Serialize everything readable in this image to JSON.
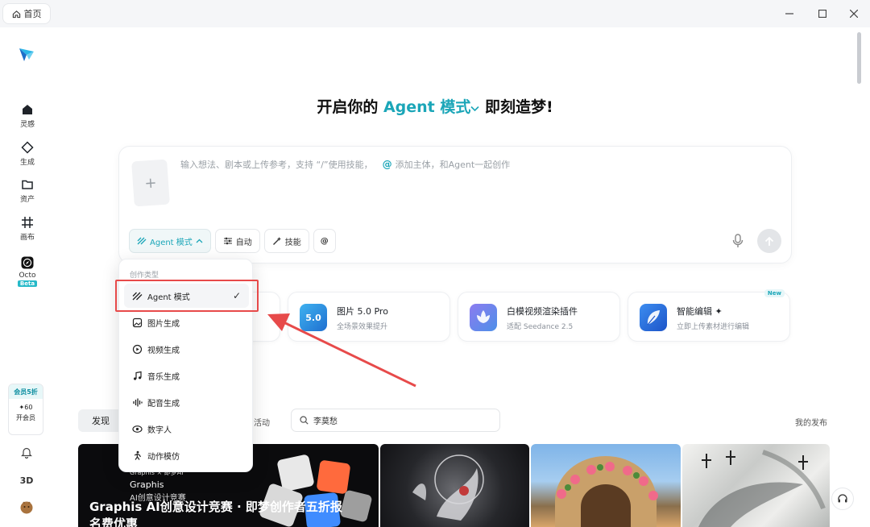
{
  "titlebar": {
    "home_label": "首页"
  },
  "sidebar": {
    "items": [
      {
        "label": "灵感",
        "icon": "home-icon"
      },
      {
        "label": "生成",
        "icon": "diamond-icon"
      },
      {
        "label": "资产",
        "icon": "folder-icon"
      },
      {
        "label": "画布",
        "icon": "canvas-icon"
      },
      {
        "label": "Octo",
        "icon": "compass-icon",
        "badge": "Beta"
      }
    ],
    "vip": {
      "tag": "会员5折",
      "credits": "✦60",
      "open": "开会员"
    },
    "bottom": {
      "label_3d": "3D"
    }
  },
  "headline": {
    "prefix": "开启你的",
    "mode": "Agent 模式",
    "suffix": "即刻造梦!"
  },
  "prompt": {
    "placeholder_a": "输入想法、剧本或上传参考，支持 “/”使用技能，",
    "placeholder_at": "@",
    "placeholder_b": "添加主体，和Agent一起创作",
    "toolbar": {
      "mode": "Agent 模式",
      "auto": "自动",
      "skill": "技能",
      "at": "@"
    }
  },
  "feature_cards": [
    {
      "title": "图片 5.0 Pro",
      "sub": "全场景效果提升",
      "icon_text": "5.0"
    },
    {
      "title": "白模视频渲染插件",
      "sub": "适配 Seedance 2.5"
    },
    {
      "title": "智能编辑 ✦",
      "sub": "立即上传素材进行编辑",
      "badge": "New"
    }
  ],
  "feed": {
    "tab_discover": "发现",
    "tab_activity": "活动",
    "search_value": "李莫愁",
    "my_publish": "我的发布",
    "promo": {
      "brand_small": "Graphis × 即梦AI",
      "line1": "Graphis",
      "line2": "AI创意设计竞赛",
      "title1": "Graphis AI创意设计竞赛 · 即梦创作者五折报",
      "title2": "名费优惠"
    }
  },
  "dropdown": {
    "header": "创作类型",
    "items": [
      {
        "label": "Agent 模式",
        "icon": "agent-icon",
        "selected": true
      },
      {
        "label": "图片生成",
        "icon": "image-icon"
      },
      {
        "label": "视频生成",
        "icon": "video-icon"
      },
      {
        "label": "音乐生成",
        "icon": "music-icon"
      },
      {
        "label": "配音生成",
        "icon": "voice-icon"
      },
      {
        "label": "数字人",
        "icon": "digital-human-icon"
      },
      {
        "label": "动作模仿",
        "icon": "motion-icon"
      }
    ],
    "check": "✓"
  },
  "colors": {
    "accent": "#1ba6b8",
    "annotation": "#e74a4a"
  }
}
